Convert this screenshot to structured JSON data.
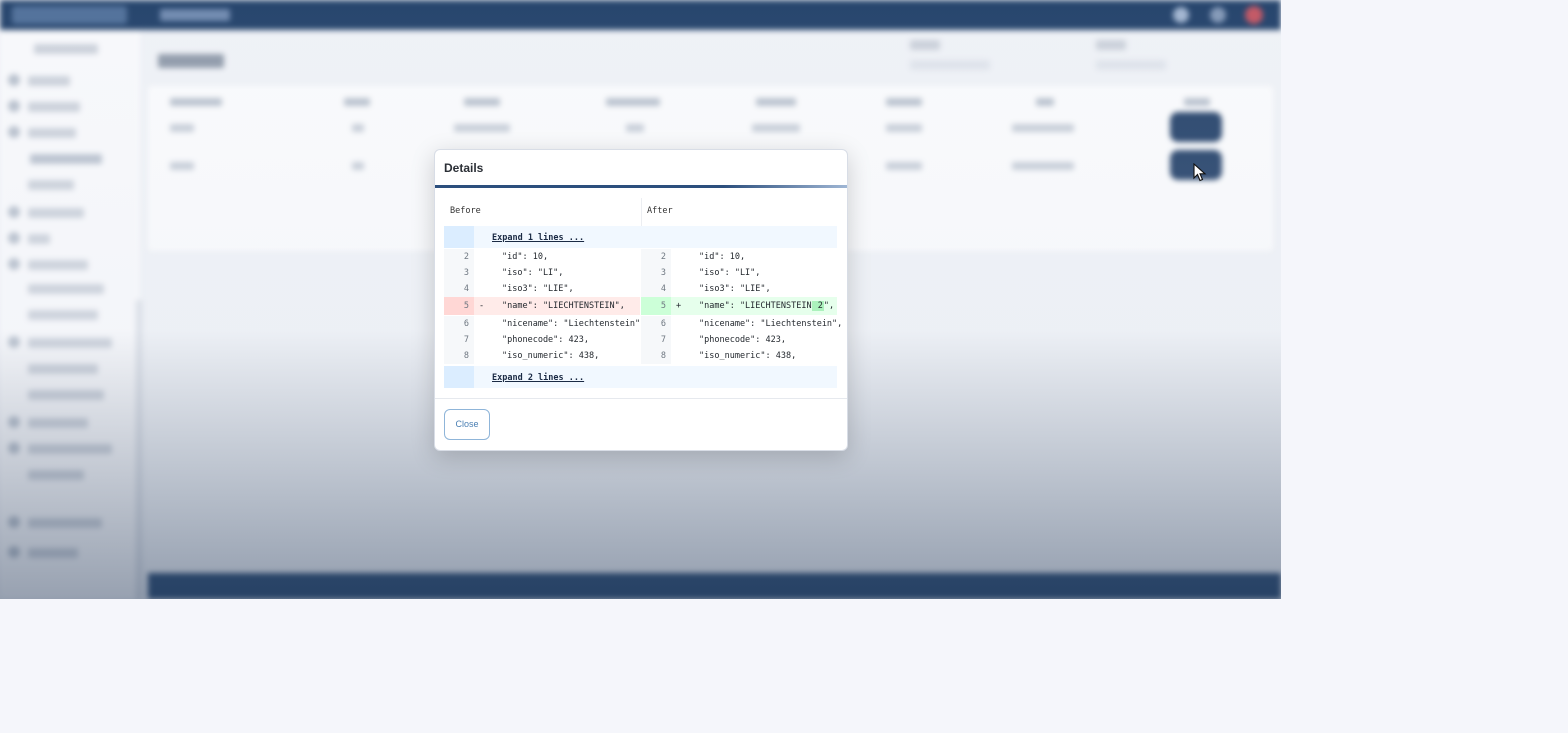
{
  "modal": {
    "title": "Details",
    "before_label": "Before",
    "after_label": "After",
    "expand_top": "Expand 1 lines ...",
    "expand_bottom": "Expand 2 lines ...",
    "close_label": "Close",
    "before_lines": [
      {
        "num": "2",
        "marker": "",
        "code": "\"id\": 10,"
      },
      {
        "num": "3",
        "marker": "",
        "code": "\"iso\": \"LI\","
      },
      {
        "num": "4",
        "marker": "",
        "code": "\"iso3\": \"LIE\","
      },
      {
        "num": "5",
        "marker": "-",
        "code": "\"name\": \"LIECHTENSTEIN\","
      },
      {
        "num": "6",
        "marker": "",
        "code": "\"nicename\": \"Liechtenstein\","
      },
      {
        "num": "7",
        "marker": "",
        "code": "\"phonecode\": 423,"
      },
      {
        "num": "8",
        "marker": "",
        "code": "\"iso_numeric\": 438,"
      }
    ],
    "after_lines": [
      {
        "num": "2",
        "marker": "",
        "code": "\"id\": 10,"
      },
      {
        "num": "3",
        "marker": "",
        "code": "\"iso\": \"LI\","
      },
      {
        "num": "4",
        "marker": "",
        "code": "\"iso3\": \"LIE\","
      },
      {
        "num": "5",
        "marker": "+",
        "code_prefix": "\"name\": \"LIECHTENSTEIN",
        "code_added": " 2",
        "code_suffix": "\","
      },
      {
        "num": "6",
        "marker": "",
        "code": "\"nicename\": \"Liechtenstein\","
      },
      {
        "num": "7",
        "marker": "",
        "code": "\"phonecode\": 423,"
      },
      {
        "num": "8",
        "marker": "",
        "code": "\"iso_numeric\": 438,"
      }
    ]
  },
  "colors": {
    "header": "#1c3c66",
    "deleted_line": "#ffebe9",
    "inserted_line": "#e6ffec",
    "inserted_highlight": "#abf2bc",
    "close_button": "#4a7fb3"
  }
}
